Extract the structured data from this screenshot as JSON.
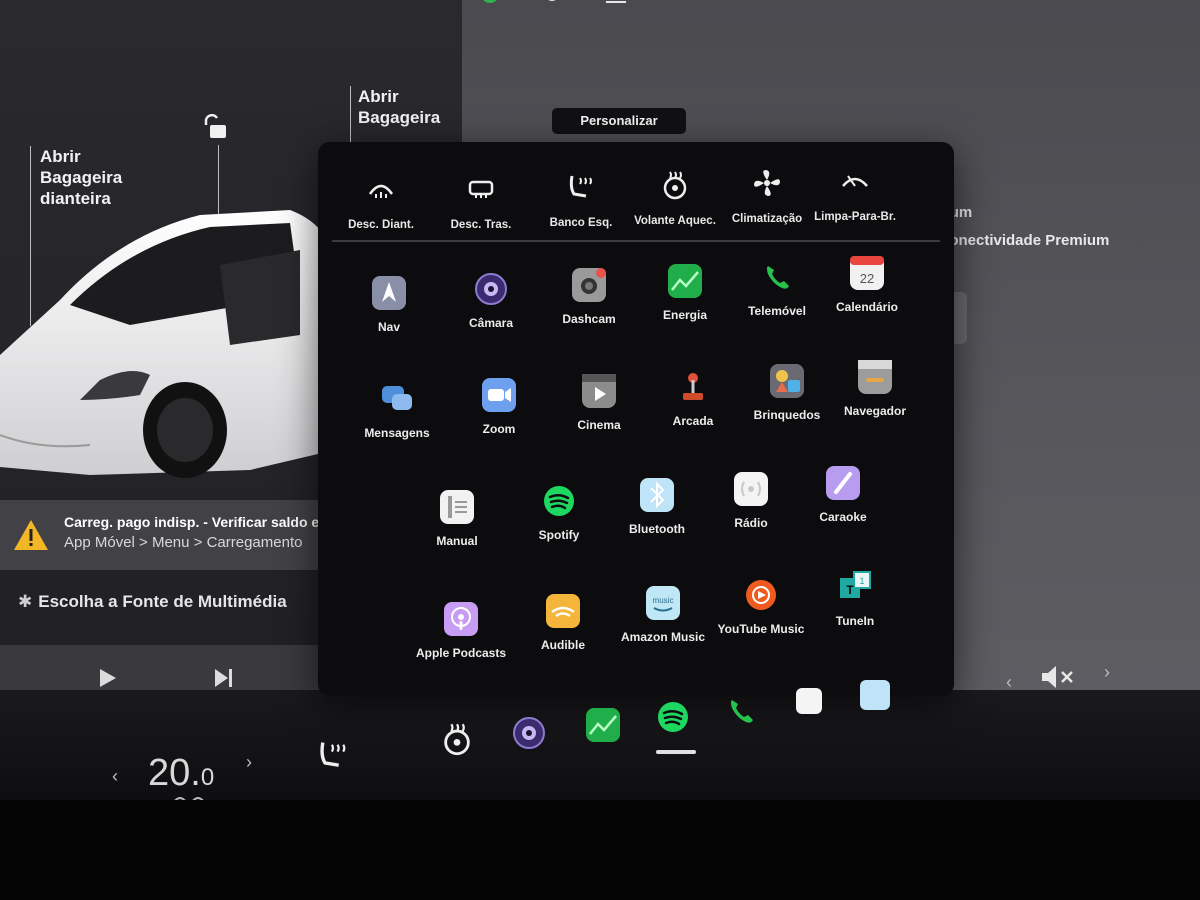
{
  "left_panel": {
    "front_trunk_label": "Abrir\nBagageira\ndianteira",
    "rear_trunk_label": "Abrir\nBagageira",
    "alert": {
      "line1": "Carreg. pago indisp. - Verificar saldo em",
      "line2": "App Móvel > Menu > Carregamento"
    },
    "media_source": "Escolha a Fonte de Multimédia"
  },
  "right_panel": {
    "text1": "Premium",
    "text2": "a Conectividade Premium"
  },
  "overlay": {
    "title": "Personalizar",
    "quick_controls": [
      {
        "label": "Desc. Diant.",
        "icon": "front-defrost-icon"
      },
      {
        "label": "Desc. Tras.",
        "icon": "rear-defrost-icon"
      },
      {
        "label": "Banco Esq.",
        "icon": "seat-heater-icon"
      },
      {
        "label": "Volante Aquec.",
        "icon": "steering-heater-icon"
      },
      {
        "label": "Climatização",
        "icon": "fan-icon"
      },
      {
        "label": "Limpa-Para-Br.",
        "icon": "wiper-icon"
      }
    ],
    "apps": [
      {
        "label": "Nav",
        "icon": "nav-icon",
        "color": "#8a8fa8"
      },
      {
        "label": "Câmara",
        "icon": "camera-icon",
        "color": "#3b2a6e"
      },
      {
        "label": "Dashcam",
        "icon": "dashcam-icon",
        "color": "#9a9a9a"
      },
      {
        "label": "Energia",
        "icon": "energy-icon",
        "color": "#1fae49"
      },
      {
        "label": "Telemóvel",
        "icon": "phone-icon",
        "color": "#27c24c"
      },
      {
        "label": "Calendário",
        "icon": "calendar-icon",
        "color": "#f1f1f1"
      },
      {
        "label": "Mensagens",
        "icon": "messages-icon",
        "color": "#4f8fd9"
      },
      {
        "label": "Zoom",
        "icon": "zoom-icon",
        "color": "#6ea0f0"
      },
      {
        "label": "Cinema",
        "icon": "cinema-icon",
        "color": "#8c8c8c"
      },
      {
        "label": "Arcada",
        "icon": "arcade-icon",
        "color": "#d04a2c"
      },
      {
        "label": "Brinquedos",
        "icon": "toybox-icon",
        "color": "#d6a74c"
      },
      {
        "label": "Navegador",
        "icon": "browser-icon",
        "color": "#9c9c9c"
      },
      {
        "label": "Manual",
        "icon": "manual-icon",
        "color": "#f2f2f2"
      },
      {
        "label": "Spotify",
        "icon": "spotify-icon",
        "color": "#1ed760"
      },
      {
        "label": "Bluetooth",
        "icon": "bluetooth-icon",
        "color": "#bfe4f7"
      },
      {
        "label": "Rádio",
        "icon": "radio-icon",
        "color": "#f4f4f4"
      },
      {
        "label": "Caraoke",
        "icon": "caraoke-icon",
        "color": "#b79cf0"
      },
      {
        "label": "Apple Podcasts",
        "icon": "podcasts-icon",
        "color": "#c79df3"
      },
      {
        "label": "Audible",
        "icon": "audible-icon",
        "color": "#f4b53a"
      },
      {
        "label": "Amazon Music",
        "icon": "amazon-music-icon",
        "color": "#bfe7f5"
      },
      {
        "label": "YouTube Music",
        "icon": "youtube-music-icon",
        "color": "#f05a1f"
      },
      {
        "label": "TuneIn",
        "icon": "tunein-icon",
        "color": "#1fa9a2"
      }
    ]
  },
  "dock": {
    "temperature": "20.0",
    "temperature_int": "20.",
    "temperature_dec": "0"
  }
}
